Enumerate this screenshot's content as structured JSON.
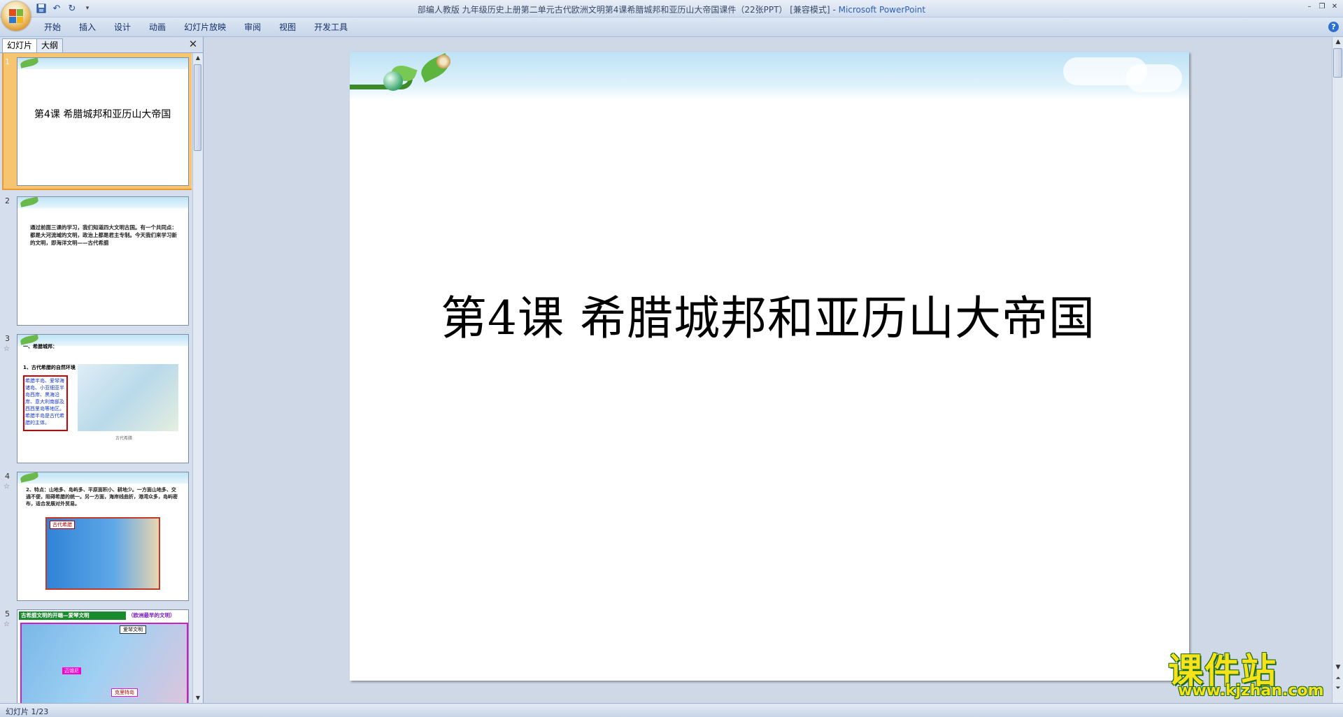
{
  "window": {
    "title": "部编人教版 九年级历史上册第二单元古代欧洲文明第4课希腊城邦和亚历山大帝国课件（22张PPT）",
    "mode": "[兼容模式]",
    "app_name": "Microsoft PowerPoint"
  },
  "ribbon": {
    "tabs": [
      "开始",
      "插入",
      "设计",
      "动画",
      "幻灯片放映",
      "审阅",
      "视图",
      "开发工具"
    ]
  },
  "left_pane": {
    "tabs": [
      "幻灯片",
      "大纲"
    ],
    "slides": [
      {
        "number": "1",
        "title": "第4课  希腊城邦和亚历山大帝国"
      },
      {
        "number": "2",
        "text": "通过前面三课的学习，我们知道四大文明古国。有一个共同点：都是大河流域的文明，政治上都是君主专制。今天我们来学习新的文明，即海洋文明——古代希腊"
      },
      {
        "number": "3",
        "heading": "一、希腊城邦：",
        "subheading": "1、古代希腊的自然环境",
        "box_text": "希腊半岛、爱琴海诸岛、小亚细亚半岛西岸、黑海沿岸、意大利南部及西西里岛等地区。希腊半岛是古代希腊的主体。",
        "caption": "古代希腊"
      },
      {
        "number": "4",
        "text": "2、特点：山地多、岛屿多、平原面积小、耕地少。一方面山地多、交通不便，阻碍希腊的统一。另一方面，海岸线曲折，港湾众多，岛屿密布，适合发展对外贸易。",
        "map_label": "古代希腊"
      },
      {
        "number": "5",
        "heading": "古希腊文明的开端—爱琴文明",
        "subheading": "（欧洲最早的文明）",
        "labels": [
          "爱琴文明",
          "迈锡尼",
          "克里特岛"
        ]
      }
    ]
  },
  "main_slide": {
    "title": "第4课  希腊城邦和亚历山大帝国"
  },
  "status_bar": {
    "text": "幻灯片 1/23"
  },
  "watermark": {
    "brand": "课件站",
    "url": "www.kjzhan.com"
  },
  "icons": {
    "office_button": "office-logo-icon",
    "save": "save-icon",
    "undo": "undo-icon",
    "redo": "redo-icon",
    "help": "help-icon"
  },
  "colors": {
    "selected_thumb": "#f7c46f",
    "ribbon": "#c7d6ea",
    "watermark_text": "#f7e21a"
  }
}
